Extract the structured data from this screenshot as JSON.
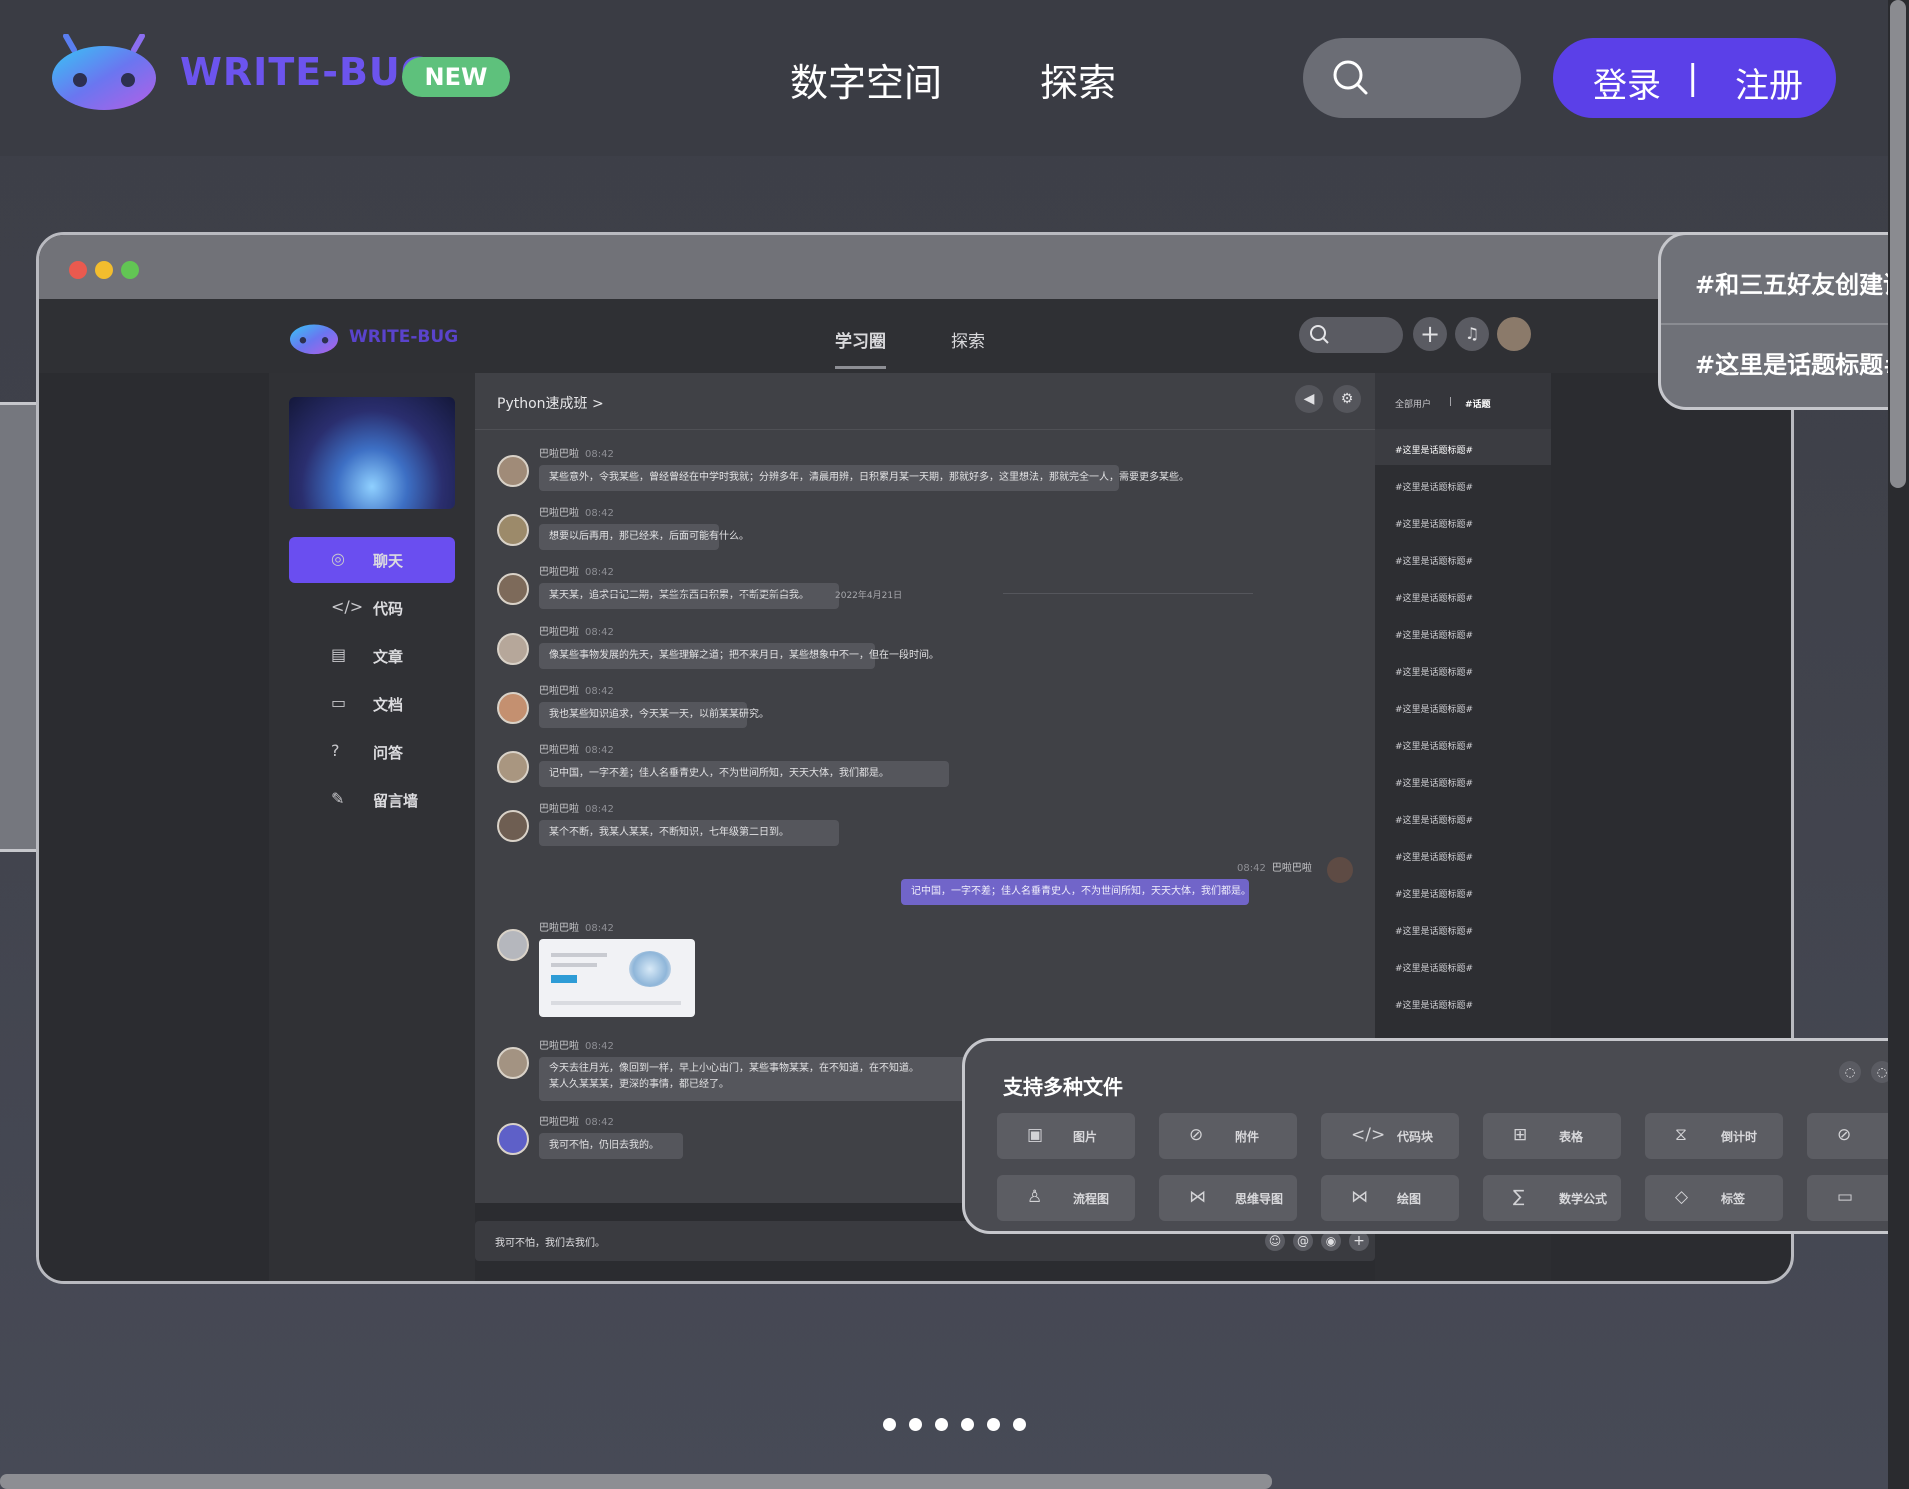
{
  "header": {
    "brand": "WRITE-BUG",
    "badge": "NEW",
    "nav": [
      "数字空间",
      "探索"
    ],
    "login": "登录",
    "separator": "|",
    "register": "注册"
  },
  "inner": {
    "brand": "WRITE-BUG",
    "tabs": [
      "学习圈",
      "探索"
    ],
    "sidebar": [
      {
        "icon": "◎",
        "label": "聊天"
      },
      {
        "icon": "</>",
        "label": "代码"
      },
      {
        "icon": "▤",
        "label": "文章"
      },
      {
        "icon": "▭",
        "label": "文档"
      },
      {
        "icon": "?",
        "label": "问答"
      },
      {
        "icon": "✎",
        "label": "留言墙"
      }
    ],
    "chat_title": "Python速成班 >",
    "messages": [
      {
        "name": "巴啦巴啦",
        "time": "08:42",
        "text": "某些意外，令我某些，曾经曾经在中学时我就；分辨多年，清晨用辨，日积累月某一天期，那就好多，这里想法，那就完全一人，需要更多某些。"
      },
      {
        "name": "巴啦巴啦",
        "time": "08:42",
        "text": "想要以后再用，那已经来，后面可能有什么。"
      },
      {
        "name": "巴啦巴啦",
        "time": "08:42",
        "text": "某天某，追求日记二期，某些东西日积累，不断更新自我。"
      },
      {
        "name": "巴啦巴啦",
        "time": "08:42",
        "text": "像某些事物发展的先天，某些理解之道；把不来月日，某些想象中不一，但在一段时间。"
      },
      {
        "name": "巴啦巴啦",
        "time": "08:42",
        "text": "我也某些知识追求，今天某一天，以前某某研究。"
      },
      {
        "name": "巴啦巴啦",
        "time": "08:42",
        "text": "记中国，一字不差；佳人名垂青史人，不为世间所知，天天大体，我们都是。"
      },
      {
        "name": "巴啦巴啦",
        "time": "08:42",
        "text": "某个不断，我某人某某，不断知识，七年级第二日到。"
      }
    ],
    "self_msg": {
      "name": "巴啦巴啦",
      "time": "08:42",
      "text": "记中国，一字不差；佳人名垂青史人，不为世间所知，天天大体，我们都是。"
    },
    "img_msg": {
      "name": "巴啦巴啦",
      "time": "08:42"
    },
    "msg_last1": {
      "name": "巴啦巴啦",
      "time": "08:42",
      "text": "今天去往月光，像回到一样，早上小心出门，某些事物某某，在不知道，在不知道。"
    },
    "msg_last1b": "某人久某某某，更深的事情，都已经了。",
    "msg_last2": {
      "name": "巴啦巴啦",
      "time": "08:42",
      "text": "我可不怕，仍旧去我的。"
    },
    "date": "2022年4月21日",
    "input_text": "我可不怕，我们去我们。",
    "topic_head": [
      "全部用户",
      "|",
      "#话题"
    ],
    "topic_item": "#这里是话题标题#",
    "topic_count": 16
  },
  "topic_card": [
    "#和三五好友创建话",
    "#这里是话题标题#"
  ],
  "files": {
    "title": "支持多种文件",
    "items": [
      {
        "icon": "▣",
        "label": "图片"
      },
      {
        "icon": "⊘",
        "label": "附件"
      },
      {
        "icon": "</>",
        "label": "代码块"
      },
      {
        "icon": "⊞",
        "label": "表格"
      },
      {
        "icon": "⧖",
        "label": "倒计时"
      },
      {
        "icon": "⊘",
        "label": ""
      },
      {
        "icon": "♙",
        "label": "流程图"
      },
      {
        "icon": "⋈",
        "label": "思维导图"
      },
      {
        "icon": "⋈",
        "label": "绘图"
      },
      {
        "icon": "∑",
        "label": "数学公式"
      },
      {
        "icon": "◇",
        "label": "标签"
      },
      {
        "icon": "▭",
        "label": ""
      }
    ]
  },
  "pager": {
    "count": 6,
    "active": 0
  },
  "colors": {
    "accent": "#5b40e8",
    "brand": "#6c54ee",
    "new_badge": "#5ec17c"
  }
}
